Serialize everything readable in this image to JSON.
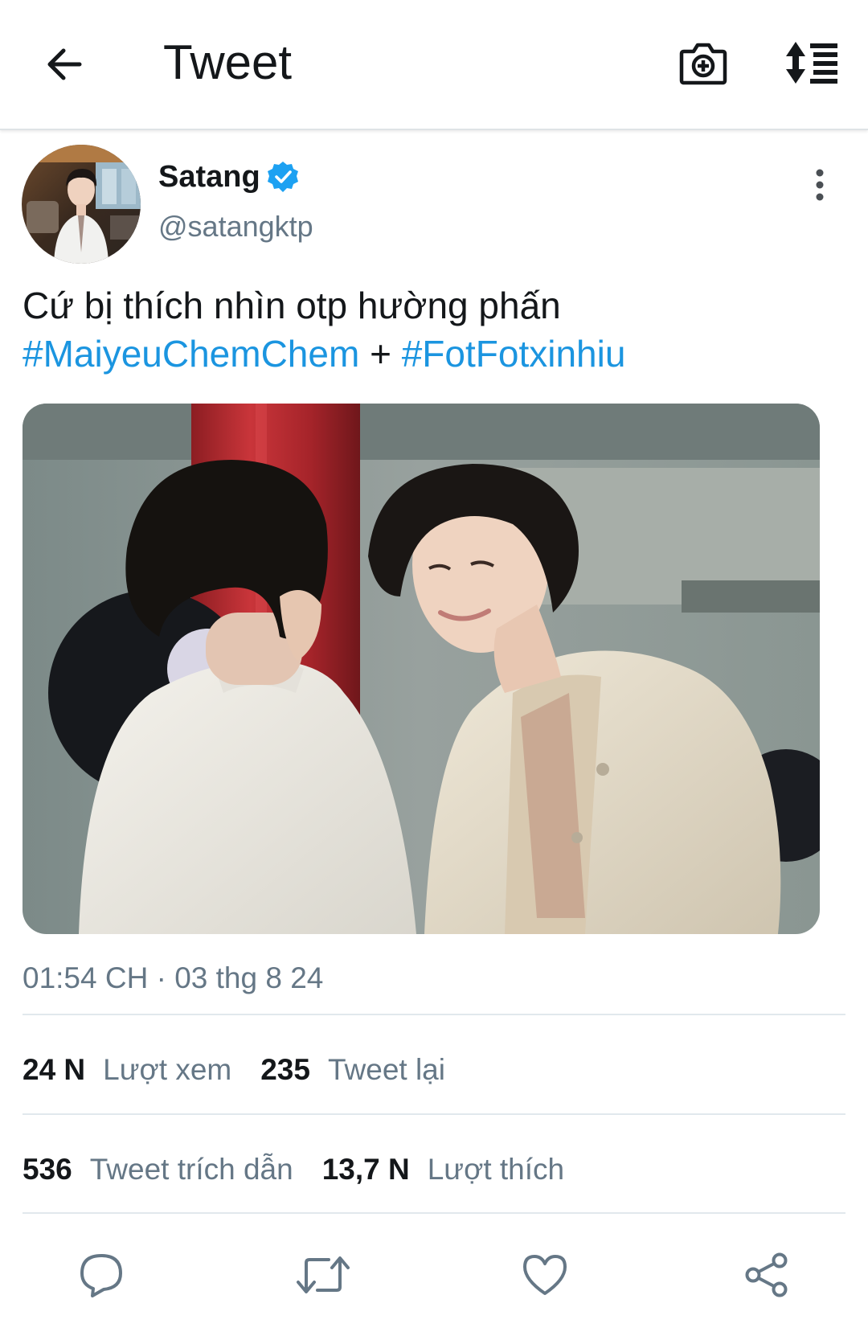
{
  "header": {
    "title": "Tweet",
    "back_icon": "arrow-left-icon",
    "camera_icon": "camera-plus-icon",
    "sort_icon": "sort-list-icon"
  },
  "author": {
    "name": "Satang",
    "handle": "@satangktp",
    "verified": true,
    "verified_color": "#1da1f2"
  },
  "tweet": {
    "text_line1": "Cứ bị thích nhìn otp hường phấn",
    "hashtag1": "#MaiyeuChemChem",
    "plus": "+",
    "hashtag2": "#FotFotxinhiu",
    "hashtag_color": "#1b95e0"
  },
  "timestamp": "01:54 CH · 03 thg 8 24",
  "stats": {
    "views_count": "24 N",
    "views_label": "Lượt xem",
    "retweets_count": "235",
    "retweets_label": "Tweet lại",
    "quotes_count": "536",
    "quotes_label": "Tweet trích dẫn",
    "likes_count": "13,7 N",
    "likes_label": "Lượt thích"
  },
  "actions": [
    "reply-icon",
    "retweet-icon",
    "like-icon",
    "share-icon"
  ]
}
